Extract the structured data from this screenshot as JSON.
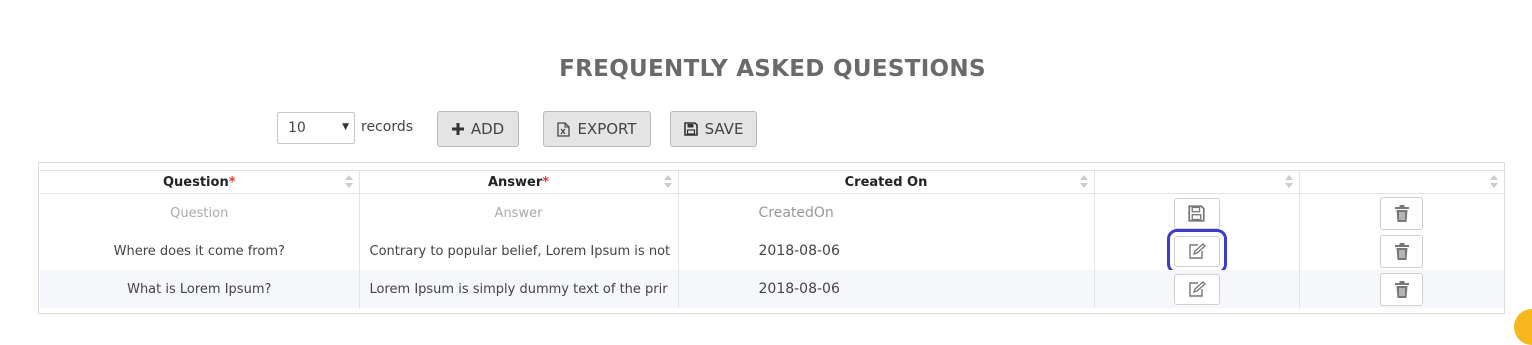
{
  "page": {
    "title": "FREQUENTLY ASKED QUESTIONS"
  },
  "toolbar": {
    "page_size": "10",
    "records_label": "records",
    "add_label": "ADD",
    "export_label": "EXPORT",
    "save_label": "SAVE"
  },
  "grid": {
    "columns": [
      {
        "label": "Question",
        "required": "*"
      },
      {
        "label": "Answer",
        "required": "*"
      },
      {
        "label": "Created On"
      },
      {
        "label": ""
      },
      {
        "label": ""
      }
    ],
    "new_row": {
      "question_placeholder": "Question",
      "answer_placeholder": "Answer",
      "created_placeholder": "CreatedOn"
    },
    "rows": [
      {
        "question": "Where does it come from?",
        "answer": "Contrary to popular belief, Lorem Ipsum is not",
        "created": "2018-08-06"
      },
      {
        "question": "What is Lorem Ipsum?",
        "answer": "Lorem Ipsum is simply dummy text of the prir",
        "created": "2018-08-06"
      }
    ]
  },
  "colors": {
    "highlight": "#3c3cc8",
    "required": "#e53935",
    "button_bg": "#e4e4e4"
  },
  "icons": [
    "chevron-down-icon",
    "plus-icon",
    "file-excel-icon",
    "floppy-icon",
    "sort-icon",
    "edit-icon",
    "trash-icon"
  ]
}
